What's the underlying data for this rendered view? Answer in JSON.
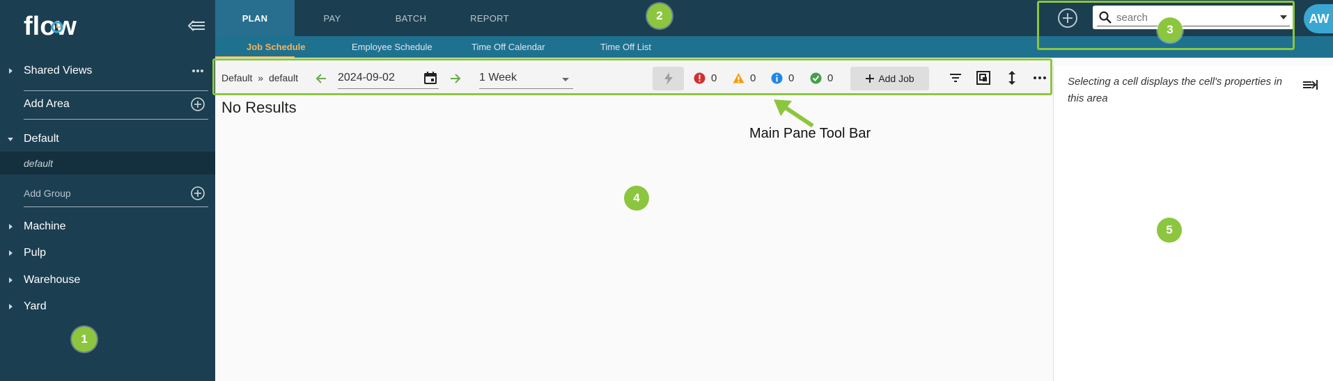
{
  "app": {
    "logo_text": "flow",
    "user_initials": "AW"
  },
  "sidebar": {
    "items": [
      {
        "label": "Shared Views"
      },
      {
        "label": "Add Area"
      },
      {
        "label": "Default"
      },
      {
        "label": "default"
      },
      {
        "label": "Add Group"
      },
      {
        "label": "Machine"
      },
      {
        "label": "Pulp"
      },
      {
        "label": "Warehouse"
      },
      {
        "label": "Yard"
      }
    ]
  },
  "topnav": {
    "tabs": [
      {
        "label": "PLAN"
      },
      {
        "label": "PAY"
      },
      {
        "label": "BATCH"
      },
      {
        "label": "REPORT"
      }
    ]
  },
  "subnav": {
    "tabs": [
      {
        "label": "Job Schedule"
      },
      {
        "label": "Employee Schedule"
      },
      {
        "label": "Time Off Calendar"
      },
      {
        "label": "Time Off List"
      }
    ]
  },
  "search": {
    "placeholder": "search"
  },
  "toolbar": {
    "breadcrumb_area": "Default",
    "breadcrumb_sep": "»",
    "breadcrumb_group": "default",
    "date": "2024-09-02",
    "period": "1 Week",
    "errors": "0",
    "warnings": "0",
    "info": "0",
    "ok": "0",
    "add_job_label": "Add Job"
  },
  "main": {
    "no_results": "No Results"
  },
  "right_pane": {
    "placeholder_text": "Selecting a cell displays the cell's properties in this area"
  },
  "annotations": {
    "toolbar_label": "Main Pane Tool Bar",
    "markers": [
      "1",
      "2",
      "3",
      "4",
      "5"
    ],
    "color": "#8cc63f"
  },
  "colors": {
    "sidebar": "#1c3e51",
    "subnav": "#1f7190",
    "active_tab": "#286f8f",
    "accent": "#f5b35a"
  }
}
